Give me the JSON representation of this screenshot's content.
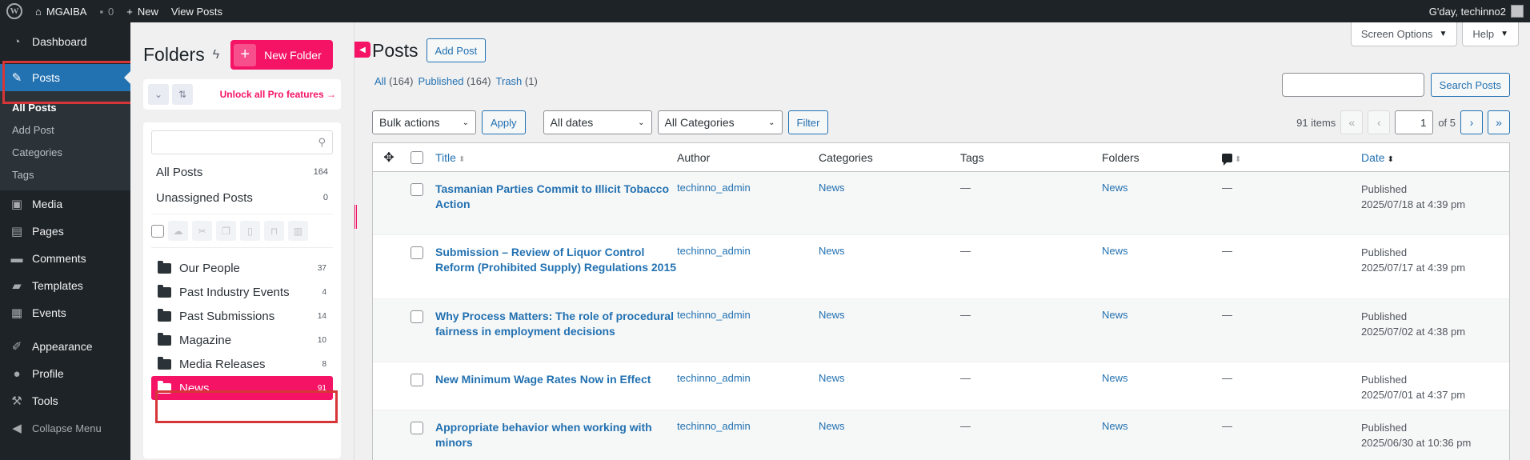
{
  "adminbar": {
    "site_name": "MGAIBA",
    "comments_count": "0",
    "new_label": "New",
    "view_posts": "View Posts",
    "greeting": "G'day, techinno2"
  },
  "sidebar": {
    "items": [
      {
        "label": "Dashboard",
        "icon": "dashboard-icon"
      },
      {
        "label": "Posts",
        "icon": "pin-icon"
      },
      {
        "label": "Media",
        "icon": "media-icon"
      },
      {
        "label": "Pages",
        "icon": "pages-icon"
      },
      {
        "label": "Comments",
        "icon": "comments-icon"
      },
      {
        "label": "Templates",
        "icon": "folder-icon"
      },
      {
        "label": "Events",
        "icon": "calendar-icon"
      },
      {
        "label": "Appearance",
        "icon": "brush-icon"
      },
      {
        "label": "Profile",
        "icon": "user-icon"
      },
      {
        "label": "Tools",
        "icon": "wrench-icon"
      },
      {
        "label": "Collapse Menu",
        "icon": "collapse-icon"
      }
    ],
    "submenu": [
      "All Posts",
      "Add Post",
      "Categories",
      "Tags"
    ]
  },
  "folders": {
    "title": "Folders",
    "new_folder": "New Folder",
    "pro_link": "Unlock all Pro features →",
    "all_posts": {
      "label": "All Posts",
      "count": "164"
    },
    "unassigned": {
      "label": "Unassigned Posts",
      "count": "0"
    },
    "list": [
      {
        "label": "Our People",
        "count": "37"
      },
      {
        "label": "Past Industry Events",
        "count": "4"
      },
      {
        "label": "Past Submissions",
        "count": "14"
      },
      {
        "label": "Magazine",
        "count": "10"
      },
      {
        "label": "Media Releases",
        "count": "8"
      },
      {
        "label": "News",
        "count": "91"
      }
    ]
  },
  "main": {
    "screen_options": "Screen Options",
    "help": "Help",
    "title": "Posts",
    "add_post": "Add Post",
    "views": {
      "all": "All",
      "all_count": "(164)",
      "published": "Published",
      "published_count": "(164)",
      "trash": "Trash",
      "trash_count": "(1)"
    },
    "search_button": "Search Posts",
    "bulk_actions": "Bulk actions",
    "apply": "Apply",
    "all_dates": "All dates",
    "all_categories": "All Categories",
    "filter": "Filter",
    "items_count": "91 items",
    "current_page": "1",
    "of_pages": "of 5",
    "columns": {
      "title": "Title",
      "author": "Author",
      "categories": "Categories",
      "tags": "Tags",
      "folders": "Folders",
      "date": "Date"
    },
    "rows": [
      {
        "title_1": "Tasmanian Parties Commit to Illicit Tobacco",
        "title_2": "Action",
        "author": "techinno_admin",
        "category": "News",
        "tags": "—",
        "folder": "News",
        "comments": "—",
        "status": "Published",
        "date": "2025/07/18 at 4:39 pm"
      },
      {
        "title_1": "Submission – Review of Liquor Control",
        "title_2": "Reform (Prohibited Supply) Regulations 2015",
        "author": "techinno_admin",
        "category": "News",
        "tags": "—",
        "folder": "News",
        "comments": "—",
        "status": "Published",
        "date": "2025/07/17 at 4:39 pm"
      },
      {
        "title_1": "Why Process Matters: The role of procedural",
        "title_2": "fairness in employment decisions",
        "author": "techinno_admin",
        "category": "News",
        "tags": "—",
        "folder": "News",
        "comments": "—",
        "status": "Published",
        "date": "2025/07/02 at 4:38 pm"
      },
      {
        "title_1": "New Minimum Wage Rates Now in Effect",
        "title_2": "",
        "author": "techinno_admin",
        "category": "News",
        "tags": "—",
        "folder": "News",
        "comments": "—",
        "status": "Published",
        "date": "2025/07/01 at 4:37 pm"
      },
      {
        "title_1": "Appropriate behavior when working with",
        "title_2": "minors",
        "author": "techinno_admin",
        "category": "News",
        "tags": "—",
        "folder": "News",
        "comments": "—",
        "status": "Published",
        "date": "2025/06/30 at 10:36 pm"
      }
    ]
  },
  "colors": {
    "accent": "#f51366",
    "wp_blue": "#2271b1",
    "highlight": "#d63638"
  }
}
